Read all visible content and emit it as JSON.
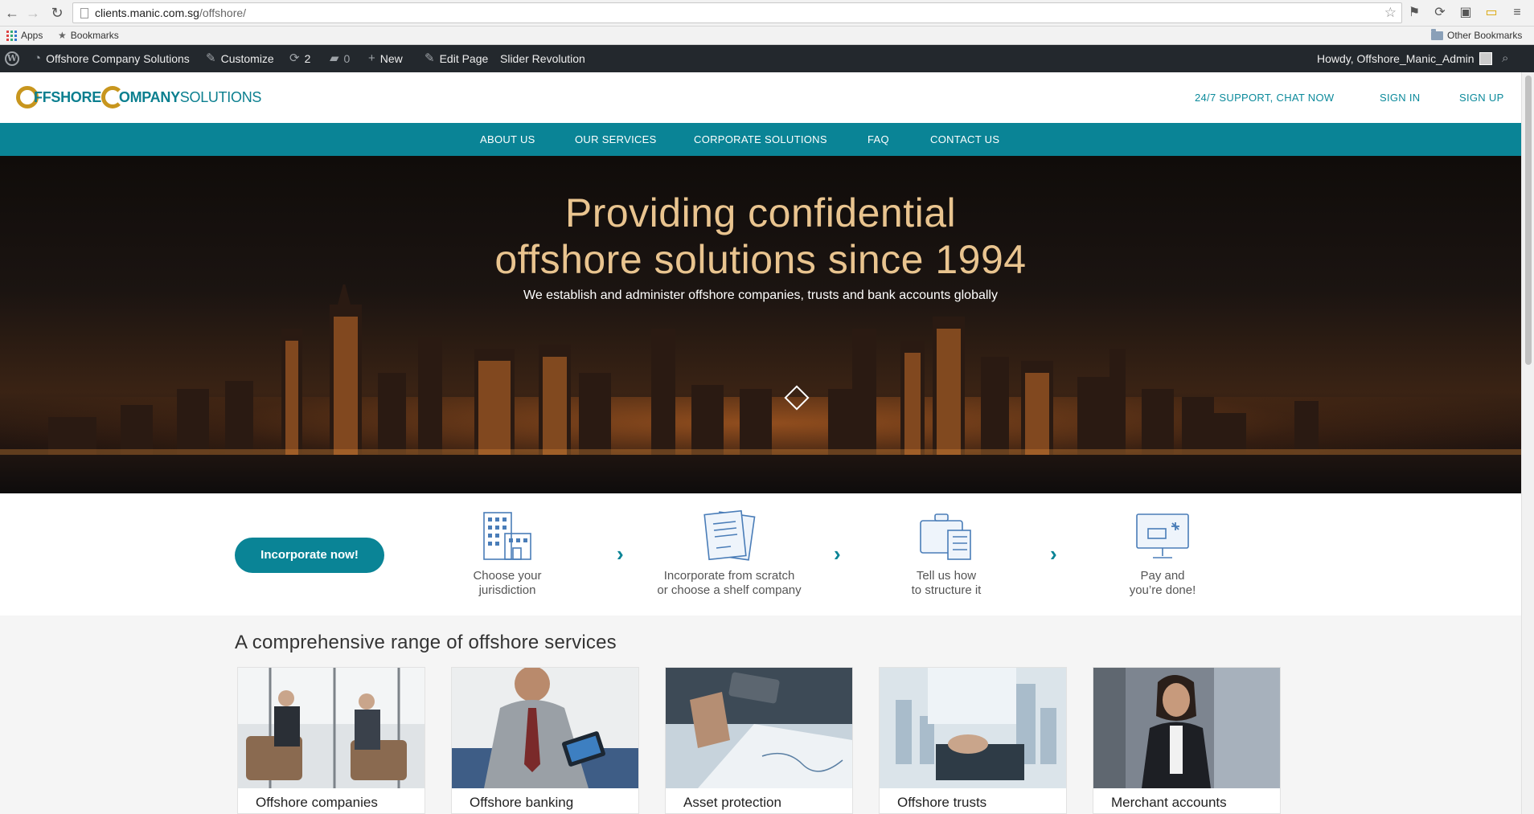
{
  "browser": {
    "url_host": "clients.manic.com.sg",
    "url_path": "/offshore/",
    "bookmarks": {
      "apps": "Apps",
      "bookmarks": "Bookmarks",
      "other": "Other Bookmarks"
    }
  },
  "wp_bar": {
    "site_name": "Offshore Company Solutions",
    "customize": "Customize",
    "updates_count": "2",
    "comments_count": "0",
    "new": "New",
    "edit_page": "Edit Page",
    "slider": "Slider Revolution",
    "howdy": "Howdy, Offshore_Manic_Admin"
  },
  "header": {
    "logo": {
      "o": "O",
      "ffshore": "FFSHORE",
      "c": "C",
      "ompany": "OMPANY",
      "solutions": "SOLUTIONS"
    },
    "support": "24/7 SUPPORT, CHAT NOW",
    "sign_in": "SIGN IN",
    "sign_up": "SIGN UP"
  },
  "nav": {
    "items": [
      "ABOUT US",
      "OUR SERVICES",
      "CORPORATE SOLUTIONS",
      "FAQ",
      "CONTACT US"
    ]
  },
  "hero": {
    "title_line1": "Providing confidential",
    "title_line2": "offshore solutions since 1994",
    "subtitle": "We establish and administer offshore companies, trusts and bank accounts globally"
  },
  "steps": {
    "cta": "Incorporate now!",
    "items": [
      {
        "line1": "Choose your",
        "line2": "jurisdiction",
        "icon": "buildings-icon"
      },
      {
        "line1": "Incorporate from scratch",
        "line2": "or choose a shelf company",
        "icon": "documents-icon"
      },
      {
        "line1": "Tell us how",
        "line2": "to structure it",
        "icon": "briefcase-icon"
      },
      {
        "line1": "Pay and",
        "line2": "you’re done!",
        "icon": "computer-payment-icon"
      }
    ]
  },
  "services": {
    "title": "A comprehensive range of offshore services",
    "cards": [
      {
        "label": "Offshore companies"
      },
      {
        "label": "Offshore banking"
      },
      {
        "label": "Asset protection"
      },
      {
        "label": "Offshore trusts"
      },
      {
        "label": "Merchant accounts"
      }
    ]
  },
  "colors": {
    "brand_teal": "#0a8496",
    "brand_gold": "#c8961e",
    "hero_title": "#e9c48f",
    "wp_bar": "#23282d"
  }
}
